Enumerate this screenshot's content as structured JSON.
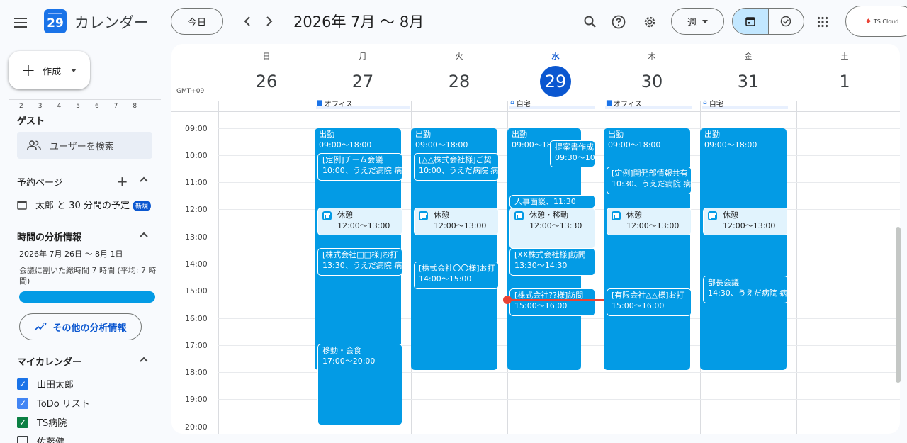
{
  "header": {
    "app_title": "カレンダー",
    "logo_day": "29",
    "today_label": "今日",
    "prev_label": "‹",
    "next_label": "›",
    "date_range": "2026年 7月 〜 8月",
    "view_label": "週",
    "account_label": "TS Cloud",
    "icons": [
      "menu-icon",
      "search-icon",
      "help-icon",
      "settings-icon",
      "calendar-view-icon",
      "tasks-view-icon",
      "apps-grid-icon"
    ]
  },
  "sidebar": {
    "create_label": "作成",
    "mini_days": [
      "2",
      "3",
      "4",
      "5",
      "6",
      "7",
      "8"
    ],
    "guest_heading": "ゲスト",
    "search_users_label": "ユーザーを検索",
    "booking_heading": "予約ページ",
    "booking_item": "太郎 と 30 分間の予定",
    "booking_badge": "新規",
    "analytics_heading": "時間の分析情報",
    "analytics_range": "2026年 7月 26日 〜 8月 1日",
    "analytics_text": "会議に割いた総時間 7 時間 (平均: 7 時間)",
    "more_analytics_label": "その他の分析情報",
    "my_calendars_heading": "マイカレンダー",
    "calendars": [
      {
        "name": "山田太郎",
        "checked": true,
        "color": "#1a73e8"
      },
      {
        "name": "ToDo リスト",
        "checked": true,
        "color": "#4285f4"
      },
      {
        "name": "TS病院",
        "checked": true,
        "color": "#0b8043"
      },
      {
        "name": "佐藤健二",
        "checked": false,
        "color": "#3c4043"
      }
    ]
  },
  "calendar": {
    "timezone": "GMT+09",
    "days": [
      {
        "dow": "日",
        "num": "26"
      },
      {
        "dow": "月",
        "num": "27"
      },
      {
        "dow": "火",
        "num": "28"
      },
      {
        "dow": "水",
        "num": "29",
        "today": true
      },
      {
        "dow": "木",
        "num": "30"
      },
      {
        "dow": "金",
        "num": "31"
      },
      {
        "dow": "土",
        "num": "1"
      }
    ],
    "working_locations": {
      "mon": "オフィス",
      "wed": "自宅",
      "thu": "オフィス",
      "fri": "自宅"
    },
    "times": [
      "09:00",
      "10:00",
      "11:00",
      "12:00",
      "13:00",
      "14:00",
      "15:00",
      "16:00",
      "17:00",
      "18:00",
      "19:00",
      "20:00"
    ],
    "events": {
      "mon_work": {
        "title": "出勤",
        "time": "09:00〜18:00"
      },
      "mon_meeting": {
        "title": "[定例]チーム会議",
        "time": "10:00、うえだ病院 病"
      },
      "mon_break": {
        "title": "休憩",
        "time": "12:00〜13:00"
      },
      "mon_visit": {
        "title": "[株式会社□□様]お打",
        "time": "13:30、うえだ病院 病"
      },
      "mon_dinner": {
        "title": "移動・会食",
        "time": "17:00〜20:00"
      },
      "tue_work": {
        "title": "出勤",
        "time": "09:00〜18:00"
      },
      "tue_visit": {
        "title": "[△△株式会社様]ご契",
        "time": "10:00、うえだ病院 病"
      },
      "tue_break": {
        "title": "休憩",
        "time": "12:00〜13:00"
      },
      "tue_visit2": {
        "title": "[株式会社〇〇様]お打",
        "time": "14:00〜15:00"
      },
      "wed_work": {
        "title": "出勤",
        "time": "09:00〜18:00"
      },
      "wed_doc": {
        "title": "提案書作成",
        "time": "09:30〜10"
      },
      "wed_interview": {
        "title": "人事面談、11:30"
      },
      "wed_break": {
        "title": "休憩・移動",
        "time": "12:00〜13:30"
      },
      "wed_visit": {
        "title": "[XX株式会社様]訪問",
        "time": "13:30〜14:30"
      },
      "wed_visit2": {
        "title": "[株式会社??様]訪問",
        "time": "15:00〜16:00"
      },
      "thu_work": {
        "title": "出勤",
        "time": "09:00〜18:00"
      },
      "thu_share": {
        "title": "[定例]開発部情報共有",
        "time": "10:30、うえだ病院 病"
      },
      "thu_break": {
        "title": "休憩",
        "time": "12:00〜13:00"
      },
      "thu_visit": {
        "title": "[有限会社△△様]お打",
        "time": "15:00〜16:00"
      },
      "fri_work": {
        "title": "出勤",
        "time": "09:00〜18:00"
      },
      "fri_break": {
        "title": "休憩",
        "time": "12:00〜13:00"
      },
      "fri_meeting": {
        "title": "部長会議",
        "time": "14:30、うえだ病院 病"
      }
    }
  }
}
